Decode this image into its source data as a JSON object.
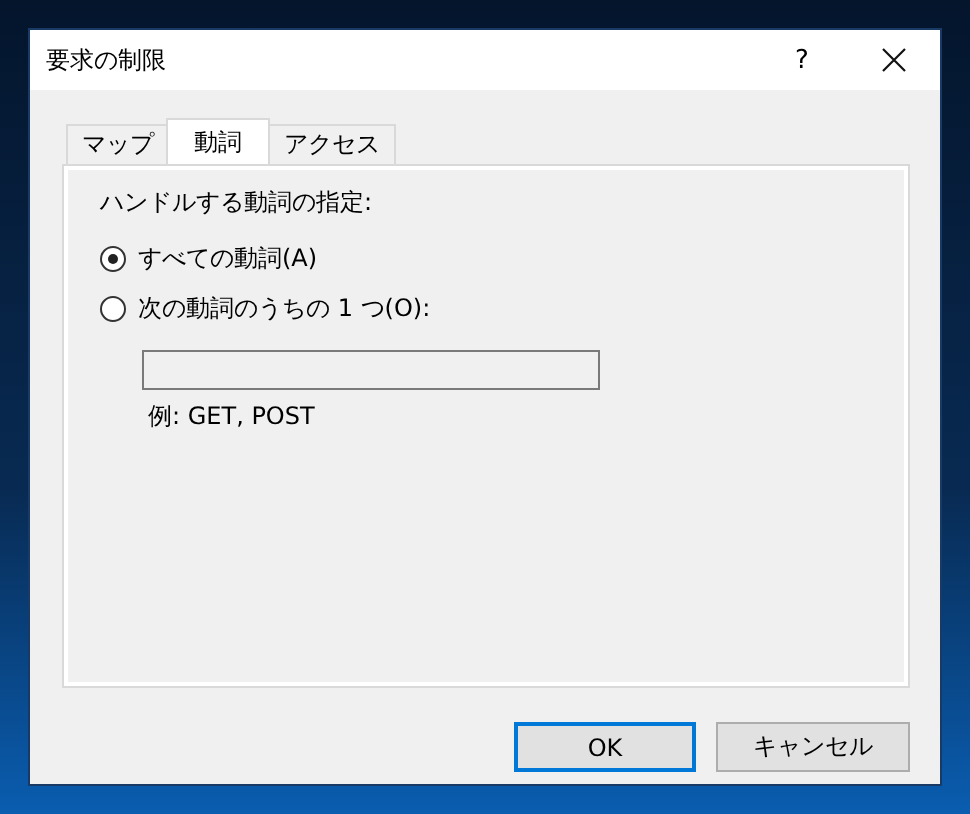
{
  "window": {
    "title": "要求の制限",
    "help": "?"
  },
  "tabs": [
    {
      "label": "マップ",
      "selected": false
    },
    {
      "label": "動詞",
      "selected": true
    },
    {
      "label": "アクセス",
      "selected": false
    }
  ],
  "group_label": "ハンドルする動詞の指定:",
  "options": [
    {
      "label": "すべての動詞(A)",
      "selected": true
    },
    {
      "label": "次の動詞のうちの 1 つ(O):",
      "selected": false
    }
  ],
  "verbs_field": {
    "hint": "例: GET, POST"
  },
  "buttons": [
    {
      "label": "OK",
      "default": true
    },
    {
      "label": "キャンセル",
      "default": false
    }
  ]
}
